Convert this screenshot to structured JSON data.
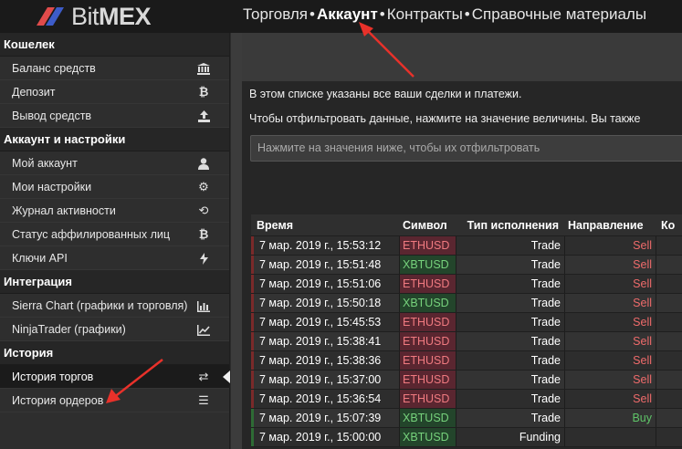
{
  "brand": {
    "name": "BitMEX",
    "name_prefix": "Bit",
    "name_suffix": "MEX"
  },
  "topnav": [
    {
      "label": "Торговля",
      "active": false
    },
    {
      "label": "Аккаунт",
      "active": true
    },
    {
      "label": "Контракты",
      "active": false
    },
    {
      "label": "Справочные материалы",
      "active": false
    }
  ],
  "sidebar": {
    "wallet": {
      "title": "Кошелек",
      "items": [
        {
          "label": "Баланс средств",
          "icon": "bank-icon"
        },
        {
          "label": "Депозит",
          "icon": "bitcoin-icon"
        },
        {
          "label": "Вывод средств",
          "icon": "upload-icon"
        }
      ]
    },
    "account": {
      "title": "Аккаунт и настройки",
      "items": [
        {
          "label": "Мой аккаунт",
          "icon": "user-icon"
        },
        {
          "label": "Мои настройки",
          "icon": "gear-icon"
        },
        {
          "label": "Журнал активности",
          "icon": "history-icon"
        },
        {
          "label": "Статус аффилированных лиц",
          "icon": "bitcoin-icon"
        },
        {
          "label": "Ключи API",
          "icon": "bolt-icon"
        }
      ]
    },
    "integration": {
      "title": "Интеграция",
      "items": [
        {
          "label": "Sierra Chart (графики и торговля)",
          "icon": "bar-chart-icon"
        },
        {
          "label": "NinjaTrader (графики)",
          "icon": "line-chart-icon"
        }
      ]
    },
    "history": {
      "title": "История",
      "items": [
        {
          "label": "История торгов",
          "icon": "exchange-icon",
          "selected": true
        },
        {
          "label": "История ордеров",
          "icon": "list-icon"
        }
      ]
    }
  },
  "main": {
    "info_line1": "В этом списке указаны все ваши сделки и платежи.",
    "info_line2": "Чтобы отфильтровать данные, нажмите на значение величины. Вы также",
    "filter_placeholder": "Нажмите на значения ниже, чтобы их отфильтровать"
  },
  "table": {
    "headers": [
      "Время",
      "Символ",
      "Тип исполнения",
      "Направление",
      "Ко"
    ],
    "rows": [
      {
        "time": "7 мар. 2019 г., 15:53:12",
        "symbol": "ETHUSD",
        "exec": "Trade",
        "dir": "Sell"
      },
      {
        "time": "7 мар. 2019 г., 15:51:48",
        "symbol": "XBTUSD",
        "exec": "Trade",
        "dir": "Sell"
      },
      {
        "time": "7 мар. 2019 г., 15:51:06",
        "symbol": "ETHUSD",
        "exec": "Trade",
        "dir": "Sell"
      },
      {
        "time": "7 мар. 2019 г., 15:50:18",
        "symbol": "XBTUSD",
        "exec": "Trade",
        "dir": "Sell"
      },
      {
        "time": "7 мар. 2019 г., 15:45:53",
        "symbol": "ETHUSD",
        "exec": "Trade",
        "dir": "Sell"
      },
      {
        "time": "7 мар. 2019 г., 15:38:41",
        "symbol": "ETHUSD",
        "exec": "Trade",
        "dir": "Sell"
      },
      {
        "time": "7 мар. 2019 г., 15:38:36",
        "symbol": "ETHUSD",
        "exec": "Trade",
        "dir": "Sell"
      },
      {
        "time": "7 мар. 2019 г., 15:37:00",
        "symbol": "ETHUSD",
        "exec": "Trade",
        "dir": "Sell"
      },
      {
        "time": "7 мар. 2019 г., 15:36:54",
        "symbol": "ETHUSD",
        "exec": "Trade",
        "dir": "Sell"
      },
      {
        "time": "7 мар. 2019 г., 15:07:39",
        "symbol": "XBTUSD",
        "exec": "Trade",
        "dir": "Buy"
      },
      {
        "time": "7 мар. 2019 г., 15:00:00",
        "symbol": "XBTUSD",
        "exec": "Funding",
        "dir": ""
      }
    ]
  },
  "colors": {
    "sell": "#ef6b6b",
    "buy": "#5fc468",
    "eth_bg": "#5a2630",
    "xbt_bg": "#23452b",
    "annotation_arrow": "#e8312a"
  }
}
